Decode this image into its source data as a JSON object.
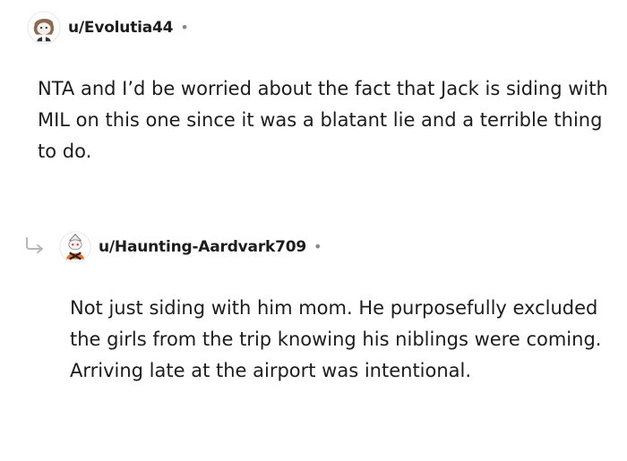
{
  "comment": {
    "author": "u/Evolutia44",
    "separator": "•",
    "avatar_icon": "snoo-avatar-icon",
    "body": "NTA and I’d be worried about the fact that Jack is siding with MIL on this one since it was a blatant lie and a terrible thing to do."
  },
  "reply": {
    "author": "u/Haunting-Aardvark709",
    "separator": "•",
    "avatar_icon": "snoo-avatar-icon",
    "reply_icon": "reply-arrow-icon",
    "body": "Not just siding with him mom. He purposefully excluded the girls from the trip knowing his niblings were coming. Arriving late at the airport was intentional."
  },
  "colors": {
    "text": "#1c1c1c",
    "meta": "#878a8c",
    "background": "#ffffff"
  }
}
